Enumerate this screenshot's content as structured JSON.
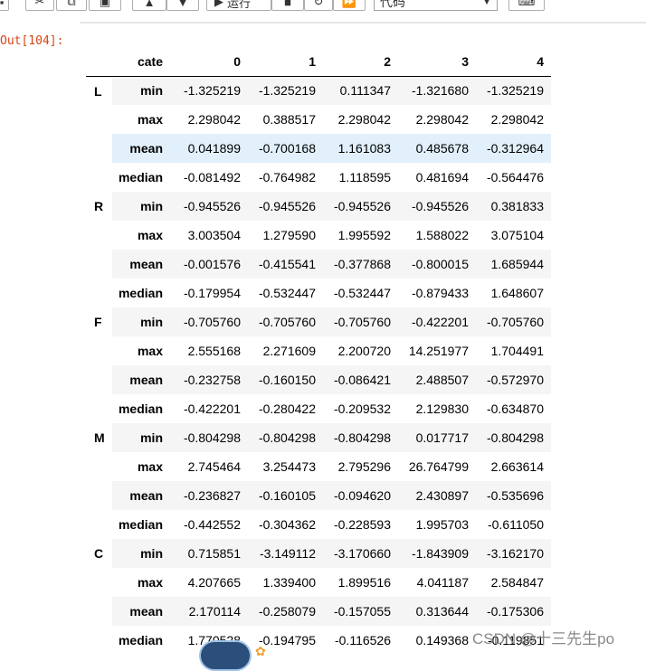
{
  "toolbar": {
    "run_label": "运行",
    "cell_type": "代码",
    "icons": [
      "save-icon",
      "cut-icon",
      "copy-icon",
      "paste-icon",
      "move-up-icon",
      "move-down-icon",
      "run-icon",
      "stop-icon",
      "restart-icon",
      "fast-forward-icon",
      "keyboard-icon"
    ]
  },
  "output": {
    "prompt": "Out[104]:",
    "columns_header": "cate",
    "columns": [
      "0",
      "1",
      "2",
      "3",
      "4"
    ],
    "groups": [
      {
        "name": "L",
        "rows": [
          {
            "stat": "min",
            "values": [
              "-1.325219",
              "-1.325219",
              "0.111347",
              "-1.321680",
              "-1.325219"
            ]
          },
          {
            "stat": "max",
            "values": [
              "2.298042",
              "0.388517",
              "2.298042",
              "2.298042",
              "2.298042"
            ]
          },
          {
            "stat": "mean",
            "values": [
              "0.041899",
              "-0.700168",
              "1.161083",
              "0.485678",
              "-0.312964"
            ]
          },
          {
            "stat": "median",
            "values": [
              "-0.081492",
              "-0.764982",
              "1.118595",
              "0.481694",
              "-0.564476"
            ]
          }
        ]
      },
      {
        "name": "R",
        "rows": [
          {
            "stat": "min",
            "values": [
              "-0.945526",
              "-0.945526",
              "-0.945526",
              "-0.945526",
              "0.381833"
            ]
          },
          {
            "stat": "max",
            "values": [
              "3.003504",
              "1.279590",
              "1.995592",
              "1.588022",
              "3.075104"
            ]
          },
          {
            "stat": "mean",
            "values": [
              "-0.001576",
              "-0.415541",
              "-0.377868",
              "-0.800015",
              "1.685944"
            ]
          },
          {
            "stat": "median",
            "values": [
              "-0.179954",
              "-0.532447",
              "-0.532447",
              "-0.879433",
              "1.648607"
            ]
          }
        ]
      },
      {
        "name": "F",
        "rows": [
          {
            "stat": "min",
            "values": [
              "-0.705760",
              "-0.705760",
              "-0.705760",
              "-0.422201",
              "-0.705760"
            ]
          },
          {
            "stat": "max",
            "values": [
              "2.555168",
              "2.271609",
              "2.200720",
              "14.251977",
              "1.704491"
            ]
          },
          {
            "stat": "mean",
            "values": [
              "-0.232758",
              "-0.160150",
              "-0.086421",
              "2.488507",
              "-0.572970"
            ]
          },
          {
            "stat": "median",
            "values": [
              "-0.422201",
              "-0.280422",
              "-0.209532",
              "2.129830",
              "-0.634870"
            ]
          }
        ]
      },
      {
        "name": "M",
        "rows": [
          {
            "stat": "min",
            "values": [
              "-0.804298",
              "-0.804298",
              "-0.804298",
              "0.017717",
              "-0.804298"
            ]
          },
          {
            "stat": "max",
            "values": [
              "2.745464",
              "3.254473",
              "2.795296",
              "26.764799",
              "2.663614"
            ]
          },
          {
            "stat": "mean",
            "values": [
              "-0.236827",
              "-0.160105",
              "-0.094620",
              "2.430897",
              "-0.535696"
            ]
          },
          {
            "stat": "median",
            "values": [
              "-0.442552",
              "-0.304362",
              "-0.228593",
              "1.995703",
              "-0.611050"
            ]
          }
        ]
      },
      {
        "name": "C",
        "rows": [
          {
            "stat": "min",
            "values": [
              "0.715851",
              "-3.149112",
              "-3.170660",
              "-1.843909",
              "-3.162170"
            ]
          },
          {
            "stat": "max",
            "values": [
              "4.207665",
              "1.339400",
              "1.899516",
              "4.041187",
              "2.584847"
            ]
          },
          {
            "stat": "mean",
            "values": [
              "2.170114",
              "-0.258079",
              "-0.157055",
              "0.313644",
              "-0.175306"
            ]
          },
          {
            "stat": "median",
            "values": [
              "1.770528",
              "-0.194795",
              "-0.116526",
              "0.149368",
              "-0.119851"
            ]
          }
        ]
      }
    ]
  },
  "watermark": "CSDN @十三先生po",
  "colors": {
    "prompt": "#d84315",
    "row_stripe": "#f5f5f5",
    "row_highlight": "#e1f0fb"
  }
}
